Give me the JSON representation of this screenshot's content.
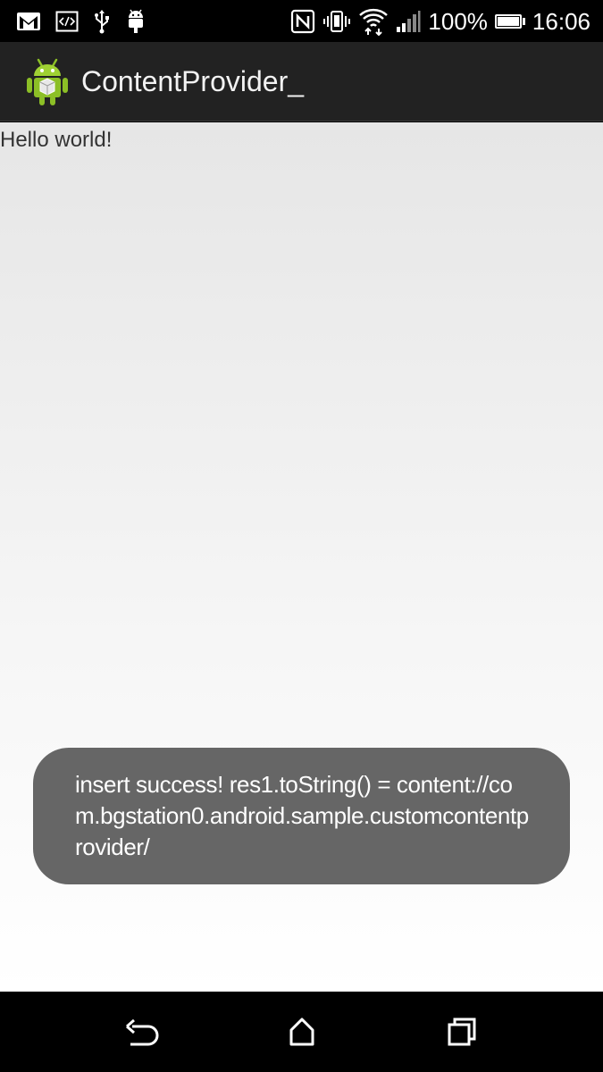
{
  "status_bar": {
    "icons_left": [
      "gmail-icon",
      "code-icon",
      "usb-icon",
      "android-debug-icon"
    ],
    "icons_right": [
      "nfc-icon",
      "vibrate-icon",
      "wifi-icon",
      "signal-icon",
      "battery-icon"
    ],
    "battery": "100%",
    "time": "16:06"
  },
  "action_bar": {
    "app_icon": "android-app-icon",
    "title": "ContentProvider_"
  },
  "main": {
    "text": "Hello world!"
  },
  "toast": {
    "message": "insert success! res1.toString() = content://com.bgstation0.android.sample.customcontentprovider/"
  },
  "nav_bar": {
    "buttons": [
      "back-icon",
      "home-icon",
      "recent-apps-icon"
    ]
  },
  "colors": {
    "status_bar_bg": "#000000",
    "action_bar_bg": "#222222",
    "toast_bg": "#666666",
    "android_green": "#8cbf26"
  }
}
